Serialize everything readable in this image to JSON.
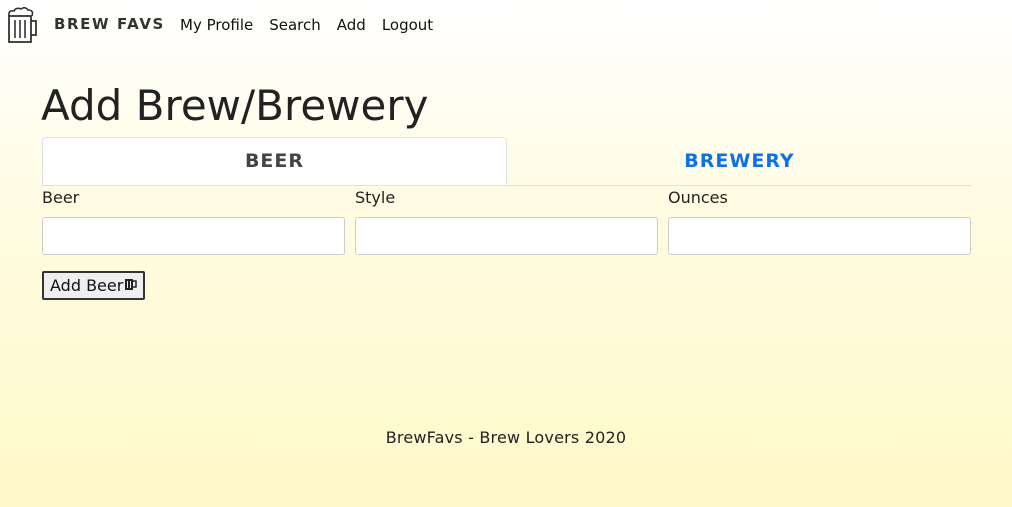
{
  "navbar": {
    "brand": "BREW FAVS",
    "links": [
      "My Profile",
      "Search",
      "Add",
      "Logout"
    ]
  },
  "main": {
    "title": "Add Brew/Brewery",
    "tabs": [
      {
        "label": "BEER",
        "active": true
      },
      {
        "label": "BREWERY",
        "active": false
      }
    ],
    "fields": [
      {
        "label": "Beer",
        "value": ""
      },
      {
        "label": "Style",
        "value": ""
      },
      {
        "label": "Ounces",
        "value": ""
      }
    ],
    "add_button": {
      "label": "Add Beer",
      "icon": "beer-mug-icon"
    }
  },
  "footer": {
    "text": "BrewFavs - Brew Lovers 2020"
  },
  "colors": {
    "accent": "#0d72ea",
    "background": "#fff8c8"
  }
}
